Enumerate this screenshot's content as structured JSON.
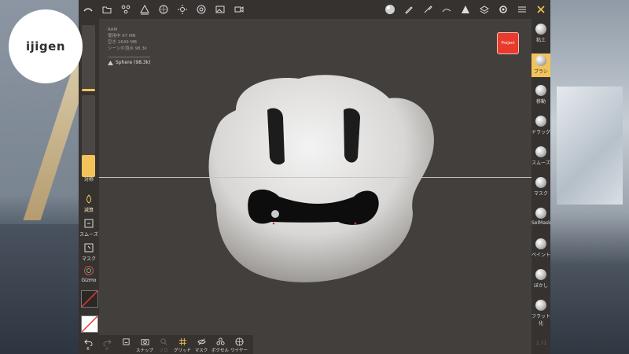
{
  "logo": {
    "text": "ijigen"
  },
  "topbar": {
    "icons": [
      "menu-icon",
      "folder-icon",
      "scene-icon",
      "mesh-icon",
      "material-icon",
      "light-icon",
      "camera-icon",
      "image-icon",
      "video-icon",
      "matcap-icon",
      "pen-icon",
      "brush-icon",
      "stroke-icon",
      "triangle-icon",
      "layers-icon",
      "settings-icon",
      "sliders-icon",
      "tools-icon"
    ]
  },
  "info": {
    "ram": "RAM",
    "used": "使用中 67 MB",
    "free": "空き 1649 MB",
    "vertices": "シーンの頂点 98.3k",
    "mesh_label": "Sphere (98.3k)"
  },
  "project_button": "Project",
  "left_toolbar": {
    "symmetry": "対称",
    "decimate": "減算",
    "smooth": "スムーズ",
    "mask": "マスク",
    "gizmo": "Gizmo",
    "radius_level": 0.04,
    "intensity_level": 0.27
  },
  "right_toolbar": [
    {
      "label": "粘土",
      "active": false
    },
    {
      "label": "ブラシ",
      "active": true
    },
    {
      "label": "移動",
      "active": false
    },
    {
      "label": "ドラッグ",
      "active": false
    },
    {
      "label": "スムーズ",
      "active": false
    },
    {
      "label": "マスク",
      "active": false
    },
    {
      "label": "SelMask",
      "active": false
    },
    {
      "label": "ペイント",
      "active": false
    },
    {
      "label": "ぼかし",
      "active": false
    },
    {
      "label": "フラット化",
      "active": false
    }
  ],
  "bottombar": {
    "undo_count": "6",
    "redo_count": "0",
    "items": [
      {
        "label": "",
        "icon": "save-icon"
      },
      {
        "label": "スナップ",
        "icon": "snapshot-icon"
      },
      {
        "label": "ソロ",
        "icon": "solo-icon"
      },
      {
        "label": "グリッド",
        "icon": "grid-icon"
      },
      {
        "label": "マスク",
        "icon": "mask-visibility-icon"
      },
      {
        "label": "ボクセル",
        "icon": "voxel-icon"
      },
      {
        "label": "ワイヤー",
        "icon": "wireframe-icon"
      }
    ]
  },
  "version": "1.71",
  "colors": {
    "accent": "#f1c35a",
    "project": "#e83a2d",
    "panel": "#353230",
    "viewport": "#433f3c"
  }
}
